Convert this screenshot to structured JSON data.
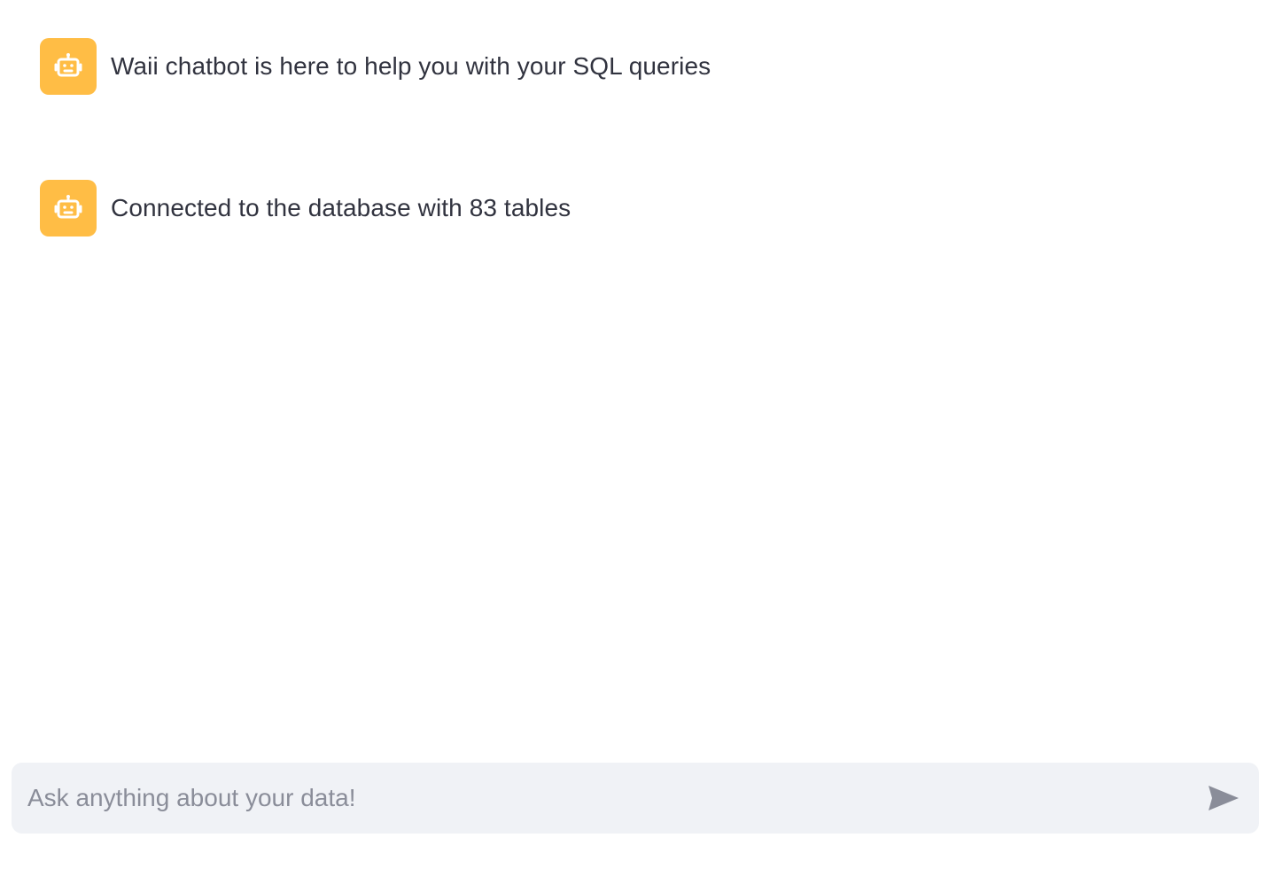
{
  "messages": [
    {
      "role": "assistant",
      "avatar_icon": "robot-icon",
      "text": "Waii chatbot is here to help you with your SQL queries"
    },
    {
      "role": "assistant",
      "avatar_icon": "robot-icon",
      "text": "Connected to the database with 83 tables"
    }
  ],
  "chat_input": {
    "placeholder": "Ask anything about your data!",
    "value": "",
    "send_icon": "send-icon"
  },
  "colors": {
    "avatar_background": "#ffbd45",
    "text": "#31333f",
    "input_background": "#f0f2f6",
    "placeholder": "#8a8d99",
    "send_icon": "#8a8d99"
  }
}
